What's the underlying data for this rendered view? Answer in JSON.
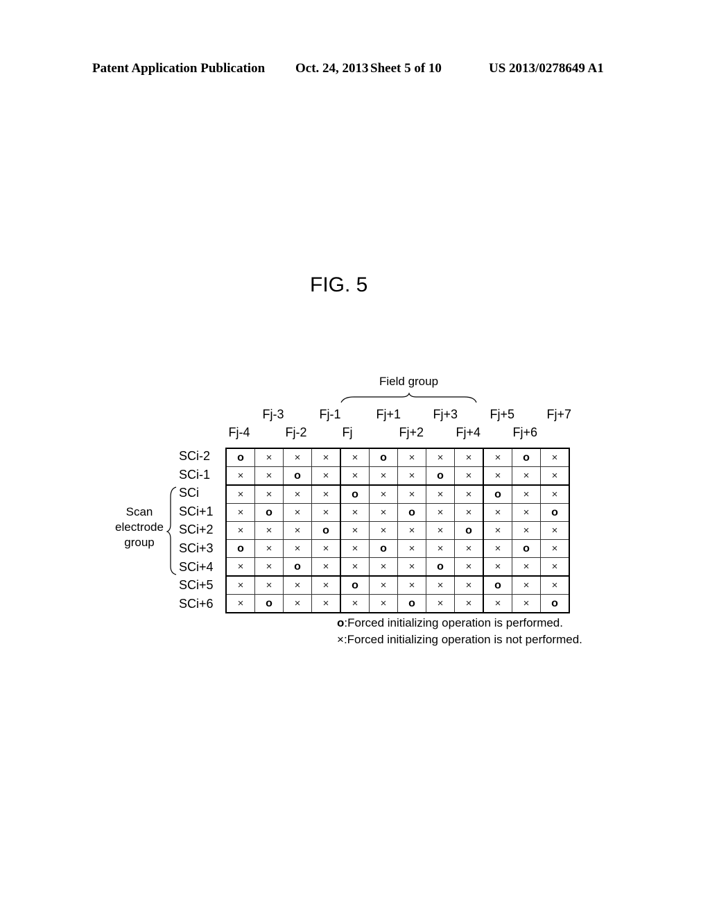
{
  "header": {
    "left": "Patent Application Publication",
    "date": "Oct. 24, 2013",
    "sheet": "Sheet 5 of 10",
    "number": "US 2013/0278649 A1"
  },
  "figure": {
    "title": "FIG. 5",
    "field_group_label": "Field group",
    "scan_group_label": [
      "Scan",
      "electrode",
      "group"
    ],
    "columns": [
      "Fj-4",
      "Fj-3",
      "Fj-2",
      "Fj-1",
      "Fj",
      "Fj+1",
      "Fj+2",
      "Fj+3",
      "Fj+4",
      "Fj+5",
      "Fj+6",
      "Fj+7"
    ],
    "rows": [
      {
        "label": "SCi-2",
        "cells": [
          "o",
          "x",
          "x",
          "x",
          "x",
          "o",
          "x",
          "x",
          "x",
          "x",
          "o",
          "x"
        ]
      },
      {
        "label": "SCi-1",
        "cells": [
          "x",
          "x",
          "o",
          "x",
          "x",
          "x",
          "x",
          "o",
          "x",
          "x",
          "x",
          "x"
        ]
      },
      {
        "label": "SCi",
        "cells": [
          "x",
          "x",
          "x",
          "x",
          "o",
          "x",
          "x",
          "x",
          "x",
          "o",
          "x",
          "x"
        ]
      },
      {
        "label": "SCi+1",
        "cells": [
          "x",
          "o",
          "x",
          "x",
          "x",
          "x",
          "o",
          "x",
          "x",
          "x",
          "x",
          "o"
        ]
      },
      {
        "label": "SCi+2",
        "cells": [
          "x",
          "x",
          "x",
          "o",
          "x",
          "x",
          "x",
          "x",
          "o",
          "x",
          "x",
          "x"
        ]
      },
      {
        "label": "SCi+3",
        "cells": [
          "o",
          "x",
          "x",
          "x",
          "x",
          "o",
          "x",
          "x",
          "x",
          "x",
          "o",
          "x"
        ]
      },
      {
        "label": "SCi+4",
        "cells": [
          "x",
          "x",
          "o",
          "x",
          "x",
          "x",
          "x",
          "o",
          "x",
          "x",
          "x",
          "x"
        ]
      },
      {
        "label": "SCi+5",
        "cells": [
          "x",
          "x",
          "x",
          "x",
          "o",
          "x",
          "x",
          "x",
          "x",
          "o",
          "x",
          "x"
        ]
      },
      {
        "label": "SCi+6",
        "cells": [
          "x",
          "o",
          "x",
          "x",
          "x",
          "x",
          "o",
          "x",
          "x",
          "x",
          "x",
          "o"
        ]
      }
    ],
    "symbols": {
      "o": "o",
      "x": "×"
    },
    "legend": [
      {
        "symbol": "o",
        "text": ":Forced initializing operation is performed."
      },
      {
        "symbol": "×",
        "text": ":Forced initializing operation is not performed."
      }
    ]
  }
}
